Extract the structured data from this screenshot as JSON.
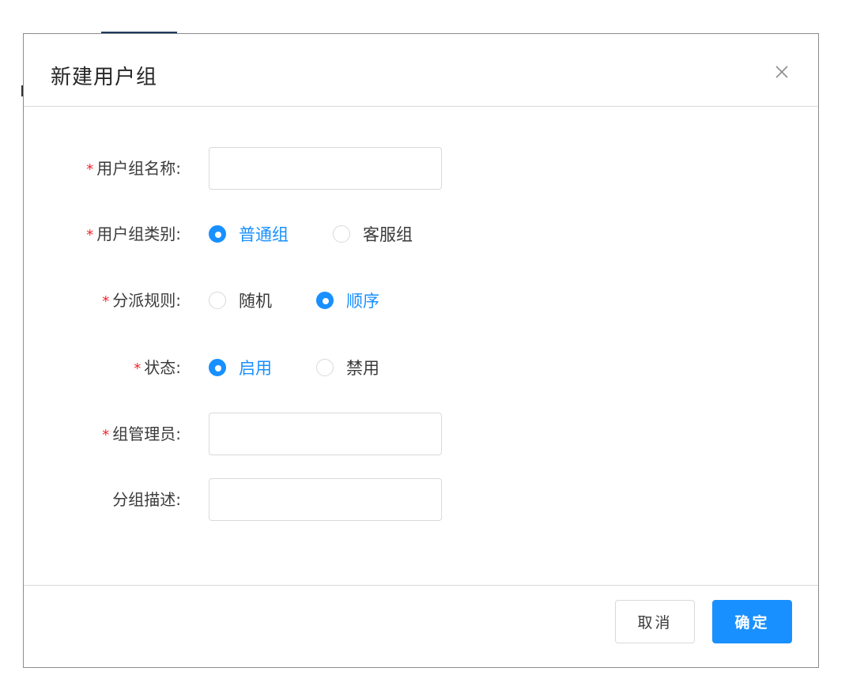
{
  "dialog": {
    "title": "新建用户组",
    "close_icon": "close-icon"
  },
  "form": {
    "group_name": {
      "label": "用户组名称:",
      "required": true,
      "value": "",
      "placeholder": ""
    },
    "group_type": {
      "label": "用户组类别:",
      "required": true,
      "options": [
        {
          "label": "普通组",
          "checked": true
        },
        {
          "label": "客服组",
          "checked": false
        }
      ]
    },
    "dispatch_rule": {
      "label": "分派规则:",
      "required": true,
      "options": [
        {
          "label": "随机",
          "checked": false
        },
        {
          "label": "顺序",
          "checked": true
        }
      ]
    },
    "status": {
      "label": "状态:",
      "required": true,
      "options": [
        {
          "label": "启用",
          "checked": true
        },
        {
          "label": "禁用",
          "checked": false
        }
      ]
    },
    "group_admin": {
      "label": "组管理员:",
      "required": true,
      "value": "",
      "placeholder": ""
    },
    "group_description": {
      "label": "分组描述:",
      "required": false,
      "value": "",
      "placeholder": ""
    }
  },
  "footer": {
    "cancel_label": "取消",
    "ok_label": "确定"
  },
  "colors": {
    "primary": "#1890ff",
    "required_mark": "#f5222d",
    "border": "#d9d9d9"
  }
}
